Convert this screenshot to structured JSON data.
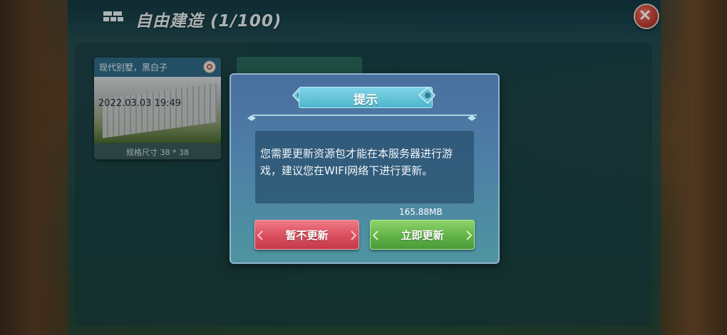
{
  "header": {
    "title": "自由建造 (1/100)",
    "icon": "build-grid-icon"
  },
  "card": {
    "title": "现代别墅，黑白子",
    "date": "2022.03.03 19:49",
    "size_label": "规格尺寸 38 * 38"
  },
  "dialog": {
    "title": "提示",
    "message": "您需要更新资源包才能在本服务器进行游戏，建议您在WIFI网络下进行更新。",
    "download_size": "165.88MB",
    "cancel_label": "暂不更新",
    "confirm_label": "立即更新"
  },
  "colors": {
    "cancel": "#d84a5a",
    "confirm": "#5eb046",
    "title_bar": "#4fb6cc",
    "close": "#b8342a"
  }
}
